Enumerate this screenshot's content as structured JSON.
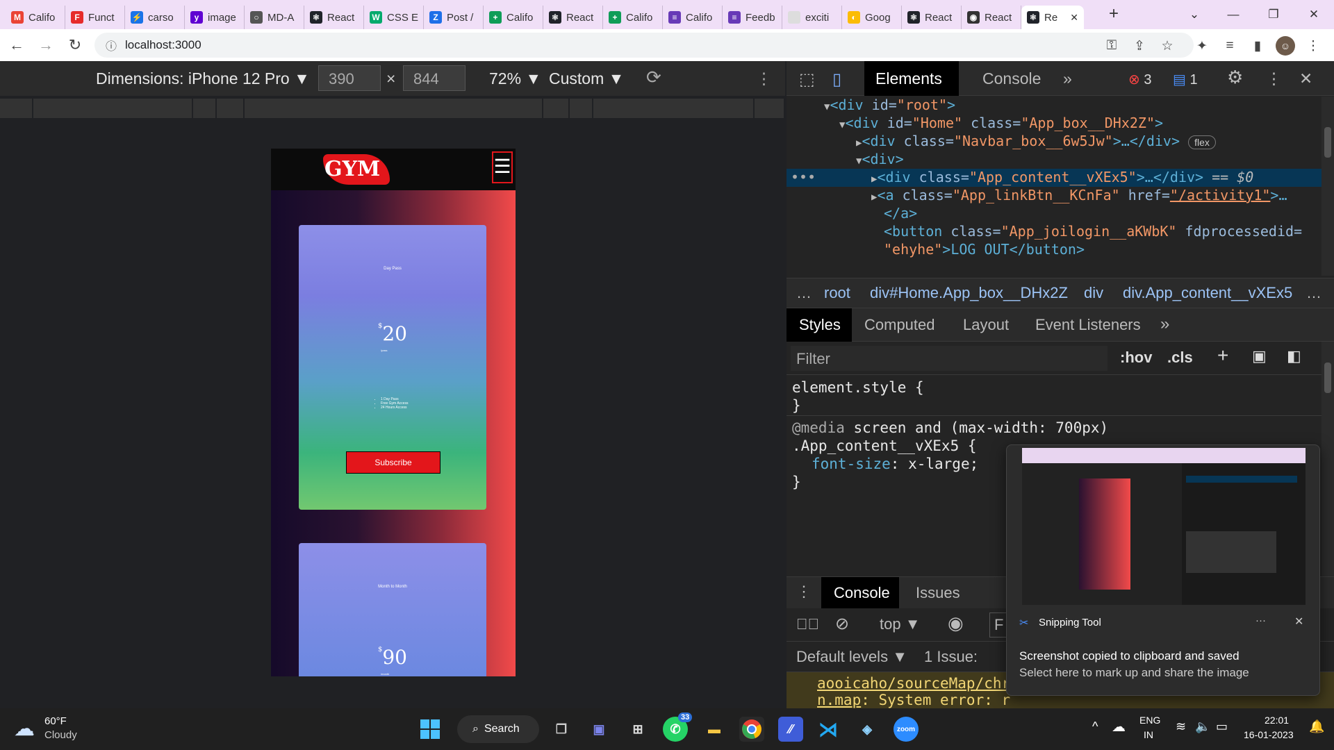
{
  "browser": {
    "tabs": [
      {
        "label": "Califo",
        "icon": "gmail-icon",
        "color": "#ea4335",
        "glyph": "M"
      },
      {
        "label": "Funct",
        "icon": "bookmark-icon",
        "color": "#e62b2b",
        "glyph": "F"
      },
      {
        "label": "carso",
        "icon": "bolt-icon",
        "color": "#1a73e8",
        "glyph": "⚡"
      },
      {
        "label": "image",
        "icon": "yahoo-icon",
        "color": "#6001d2",
        "glyph": "y"
      },
      {
        "label": "MD-A",
        "icon": "github-icon",
        "color": "#555555",
        "glyph": "○"
      },
      {
        "label": "React",
        "icon": "react-icon",
        "color": "#20232a",
        "glyph": "⚛"
      },
      {
        "label": "CSS E",
        "icon": "w3schools-icon",
        "color": "#04aa6d",
        "glyph": "W"
      },
      {
        "label": "Post /",
        "icon": "zoho-icon",
        "color": "#1e6fe8",
        "glyph": "Z"
      },
      {
        "label": "Califo",
        "icon": "sheets-icon",
        "color": "#0f9d58",
        "glyph": "+"
      },
      {
        "label": "React",
        "icon": "react-icon",
        "color": "#20232a",
        "glyph": "⚛"
      },
      {
        "label": "Califo",
        "icon": "sheets-icon",
        "color": "#0f9d58",
        "glyph": "+"
      },
      {
        "label": "Califo",
        "icon": "forms-icon",
        "color": "#673ab7",
        "glyph": "≡"
      },
      {
        "label": "Feedb",
        "icon": "forms-icon",
        "color": "#673ab7",
        "glyph": "≡"
      },
      {
        "label": "exciti",
        "icon": "page-icon",
        "color": "#dddddd",
        "glyph": ""
      },
      {
        "label": "Goog",
        "icon": "photos-icon",
        "color": "#fbbc05",
        "glyph": "◐"
      },
      {
        "label": "React",
        "icon": "react-icon",
        "color": "#20232a",
        "glyph": "⚛"
      },
      {
        "label": "React",
        "icon": "globe-icon",
        "color": "#333333",
        "glyph": "◉"
      },
      {
        "label": "Re",
        "icon": "react-icon",
        "color": "#20232a",
        "glyph": "⚛"
      }
    ],
    "url": "localhost:3000"
  },
  "device_toolbar": {
    "dimensions_label": "Dimensions: iPhone 12 Pro",
    "width": "390",
    "times": "×",
    "height": "844",
    "zoom": "72%",
    "throttle": "Custom"
  },
  "app": {
    "logo_text": "GYM",
    "menu_glyph": "☰",
    "card1": {
      "title": "Day Pass",
      "currency": "$",
      "price": "20",
      "period": "/pass",
      "features": [
        "1 Day Pass",
        "Free Gym Access",
        "24 Hours Access"
      ],
      "button": "Subscribe"
    },
    "card2": {
      "title": "Month to Month",
      "currency": "$",
      "price": "90",
      "period": "/month"
    }
  },
  "devtools": {
    "tabs": {
      "elements": "Elements",
      "console": "Console",
      "more": "»",
      "errors": "3",
      "messages": "1"
    },
    "dom": {
      "l1_tag": "<div",
      "l1_attr": " id=",
      "l1_val": "\"root\"",
      "l1_close": ">",
      "l2_tag": "<div",
      "l2_attr": " id=",
      "l2_val": "\"Home\"",
      "l2_attr2": " class=",
      "l2_val2": "\"App_box__DHx2Z\"",
      "l2_close": ">",
      "l3_tag": "<div",
      "l3_attr": " class=",
      "l3_val": "\"Navbar_box__6w5Jw\"",
      "l3_close": ">…</div>",
      "l3_badge": "flex",
      "l4_tag": "<div>",
      "l5_tag": "<div",
      "l5_attr": " class=",
      "l5_val": "\"App_content__vXEx5\"",
      "l5_close": ">…</div>",
      "l5_eq": " == $0",
      "l6_tag": "<a",
      "l6_attr": " class=",
      "l6_val": "\"App_linkBtn__KCnFa\"",
      "l6_attr2": " href=",
      "l6_val2": "\"/activity1\"",
      "l6_close": ">…",
      "l7_tag": "</a>",
      "l8_tag": "<button",
      "l8_attr": " class=",
      "l8_val": "\"App_joilogin__aKWbK\"",
      "l8_attr2": " fdprocessedid=",
      "l9_val": "\"ehyhe\"",
      "l9_rest": ">LOG OUT</button>"
    },
    "breadcrumbs": [
      "…",
      "root",
      "div#Home.App_box__DHx2Z",
      "div",
      "div.App_content__vXEx5",
      "…"
    ],
    "style_tabs": [
      "Styles",
      "Computed",
      "Layout",
      "Event Listeners",
      "»"
    ],
    "filter_placeholder": "Filter",
    "hov": ":hov",
    "cls": ".cls",
    "rules": {
      "element_style": "element.style {",
      "close": "}",
      "media_kw": "@media",
      "media_query": " screen and (max-width: 700px)",
      "selector": ".App_content__vXEx5 {",
      "prop": "font-size",
      "value": "x-large;"
    },
    "drawer": {
      "tabs": [
        "Console",
        "Issues"
      ],
      "context": "top",
      "filter_stub": "F",
      "levels": "Default levels",
      "issues": "1 Issue:",
      "warn_line1": "aooicaho/sourceMap/chr",
      "warn_line2_a": "n.map",
      "warn_line2_b": ": System error: r",
      "prompt": "›"
    }
  },
  "toast": {
    "app_name": "Snipping Tool",
    "more": "···",
    "title": "Screenshot copied to clipboard and saved",
    "subtitle": "Select here to mark up and share the image"
  },
  "taskbar": {
    "weather_temp": "60°F",
    "weather_desc": "Cloudy",
    "search_label": "Search",
    "whatsapp_badge": "33",
    "lang1": "ENG",
    "lang2": "IN",
    "time": "22:01",
    "date": "16-01-2023"
  }
}
